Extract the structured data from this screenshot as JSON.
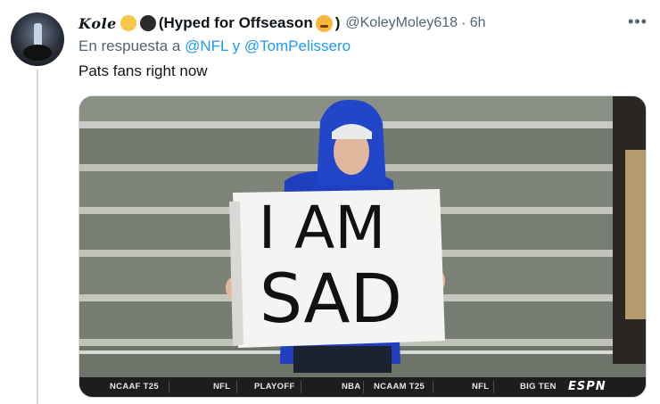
{
  "tweet": {
    "display_name": "𝑲𝒐𝒍𝒆",
    "name_suffix": "(Hyped for Offseason",
    "name_close": ")",
    "handle": "@KoleyMoley618",
    "separator": "·",
    "time": "6h",
    "more_label": "•••",
    "reply_prefix": "En respuesta a",
    "reply_to_1": "@NFL",
    "reply_joiner": "y",
    "reply_to_2": "@TomPelissero",
    "text": "Pats fans right now"
  },
  "media": {
    "sign_line_1": "I AM",
    "sign_line_2": "SAD",
    "ticker": {
      "items": [
        "NCAAF T25",
        "NFL",
        "PLAYOFF",
        "NBA",
        "NCAAM T25",
        "NFL",
        "BIG TEN"
      ],
      "network": "ESPN"
    }
  },
  "colors": {
    "link": "#1d9bf0",
    "secondary": "#536471",
    "hoodie": "#1f3fbf"
  }
}
